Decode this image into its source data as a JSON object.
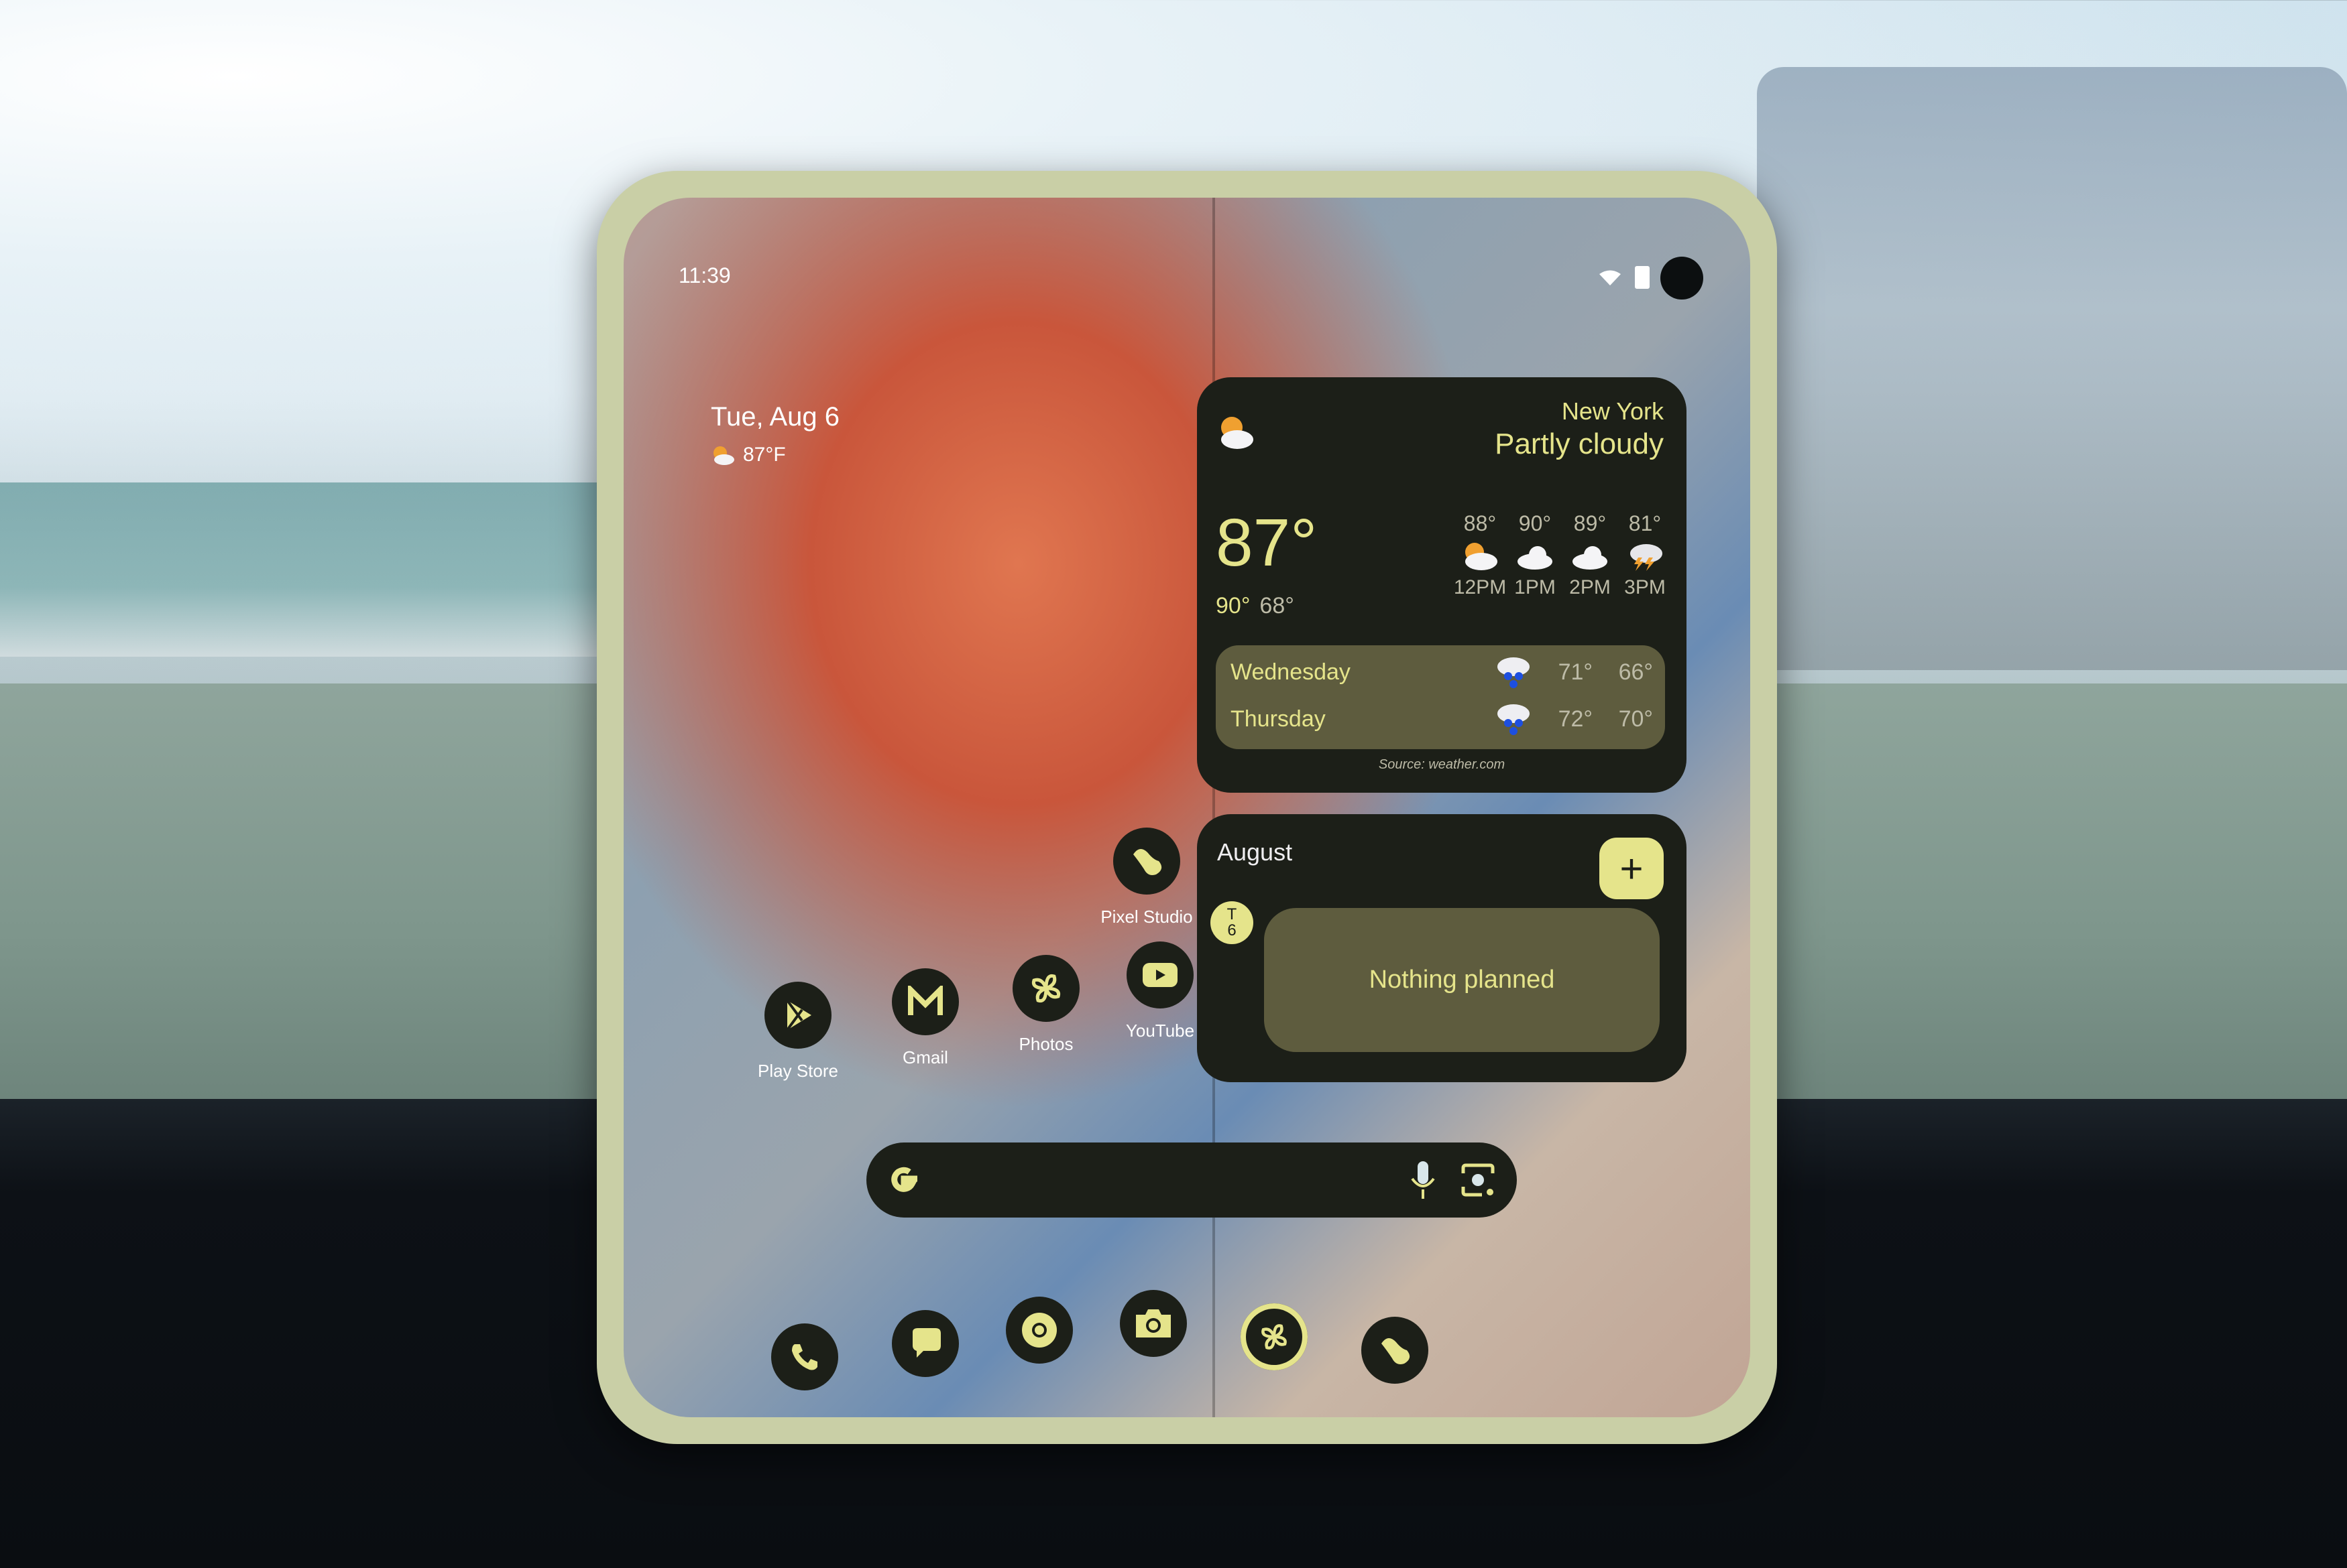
{
  "status_bar": {
    "time": "11:39",
    "icons": [
      "wifi-icon",
      "battery-icon"
    ]
  },
  "at_a_glance": {
    "date": "Tue, Aug 6",
    "weather_icon": "partly-cloudy-icon",
    "temperature": "87°F"
  },
  "weather_widget": {
    "location": "New York",
    "condition": "Partly cloudy",
    "current_temp": "87°",
    "high": "90°",
    "low": "68°",
    "hourly": [
      {
        "time": "12PM",
        "temp": "88°",
        "icon": "partly-cloudy-icon"
      },
      {
        "time": "1PM",
        "temp": "90°",
        "icon": "cloudy-icon"
      },
      {
        "time": "2PM",
        "temp": "89°",
        "icon": "cloudy-icon"
      },
      {
        "time": "3PM",
        "temp": "81°",
        "icon": "thunderstorm-icon"
      }
    ],
    "daily": [
      {
        "day": "Wednesday",
        "icon": "rain-icon",
        "high": "71°",
        "low": "66°"
      },
      {
        "day": "Thursday",
        "icon": "rain-icon",
        "high": "72°",
        "low": "70°"
      }
    ],
    "source": "Source: weather.com"
  },
  "calendar_widget": {
    "month": "August",
    "add_label": "+",
    "day_letter": "T",
    "day_number": "6",
    "empty_message": "Nothing planned"
  },
  "home_apps": [
    {
      "label": "Pixel Studio",
      "icon": "pixel-studio-icon"
    },
    {
      "label": "Play Store",
      "icon": "play-store-icon"
    },
    {
      "label": "Gmail",
      "icon": "gmail-icon"
    },
    {
      "label": "Photos",
      "icon": "photos-icon"
    },
    {
      "label": "YouTube",
      "icon": "youtube-icon"
    }
  ],
  "search_bar": {
    "icons": [
      "google-g-icon",
      "microphone-icon",
      "google-lens-icon"
    ]
  },
  "dock": [
    {
      "app": "Phone",
      "icon": "phone-icon"
    },
    {
      "app": "Messages",
      "icon": "messages-icon"
    },
    {
      "app": "Chrome",
      "icon": "chrome-icon"
    },
    {
      "app": "Camera",
      "icon": "camera-icon"
    },
    {
      "app": "Photos",
      "icon": "photos-icon"
    },
    {
      "app": "Pixel Studio",
      "icon": "pixel-studio-icon"
    }
  ],
  "theme": {
    "accent": "#e5e48b",
    "widget_bg": "#1c1f18",
    "inner_bg": "#5e5c3e",
    "muted_text": "#bdbba7"
  }
}
